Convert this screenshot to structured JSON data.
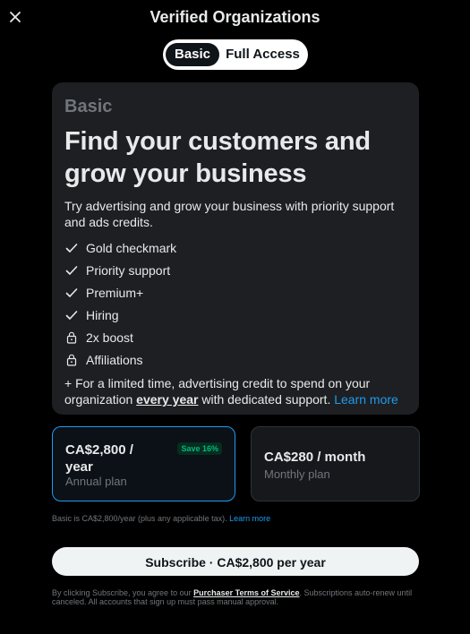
{
  "header": {
    "title": "Verified Organizations",
    "close_icon": "close-icon"
  },
  "tabs": [
    {
      "label": "Basic",
      "active": true
    },
    {
      "label": "Full Access",
      "active": false
    }
  ],
  "card": {
    "tier": "Basic",
    "headline": "Find your customers and grow your business",
    "description": "Try advertising and grow your business with priority support and ads credits.",
    "features": [
      {
        "label": "Gold checkmark",
        "icon": "check-icon"
      },
      {
        "label": "Priority support",
        "icon": "check-icon"
      },
      {
        "label": "Premium+",
        "icon": "check-icon"
      },
      {
        "label": "Hiring",
        "icon": "check-icon"
      },
      {
        "label": "2x boost",
        "icon": "lock-icon"
      },
      {
        "label": "Affiliations",
        "icon": "lock-icon"
      }
    ],
    "promo_prefix": "+ For a limited time, advertising credit to spend on your organization ",
    "promo_emphasis": "every year",
    "promo_suffix": " with dedicated support. ",
    "promo_link": "Learn more"
  },
  "plans": {
    "annual": {
      "price": "CA$2,800 / year",
      "label": "Annual plan",
      "badge": "Save 16%",
      "selected": true
    },
    "monthly": {
      "price": "CA$280 / month",
      "label": "Monthly plan",
      "selected": false
    }
  },
  "note": {
    "text": "Basic is CA$2,800/year (plus any applicable tax). ",
    "link": "Learn more"
  },
  "subscribe_label": "Subscribe · CA$2,800 per year",
  "legal": {
    "prefix": "By clicking Subscribe, you agree to our ",
    "link": "Purchaser Terms of Service",
    "suffix": ". Subscriptions auto-renew until canceled. All accounts that sign up must pass manual approval."
  },
  "colors": {
    "accent": "#1d9bf0",
    "save_badge": "#00ba7c",
    "card_bg": "#1e1f22"
  }
}
